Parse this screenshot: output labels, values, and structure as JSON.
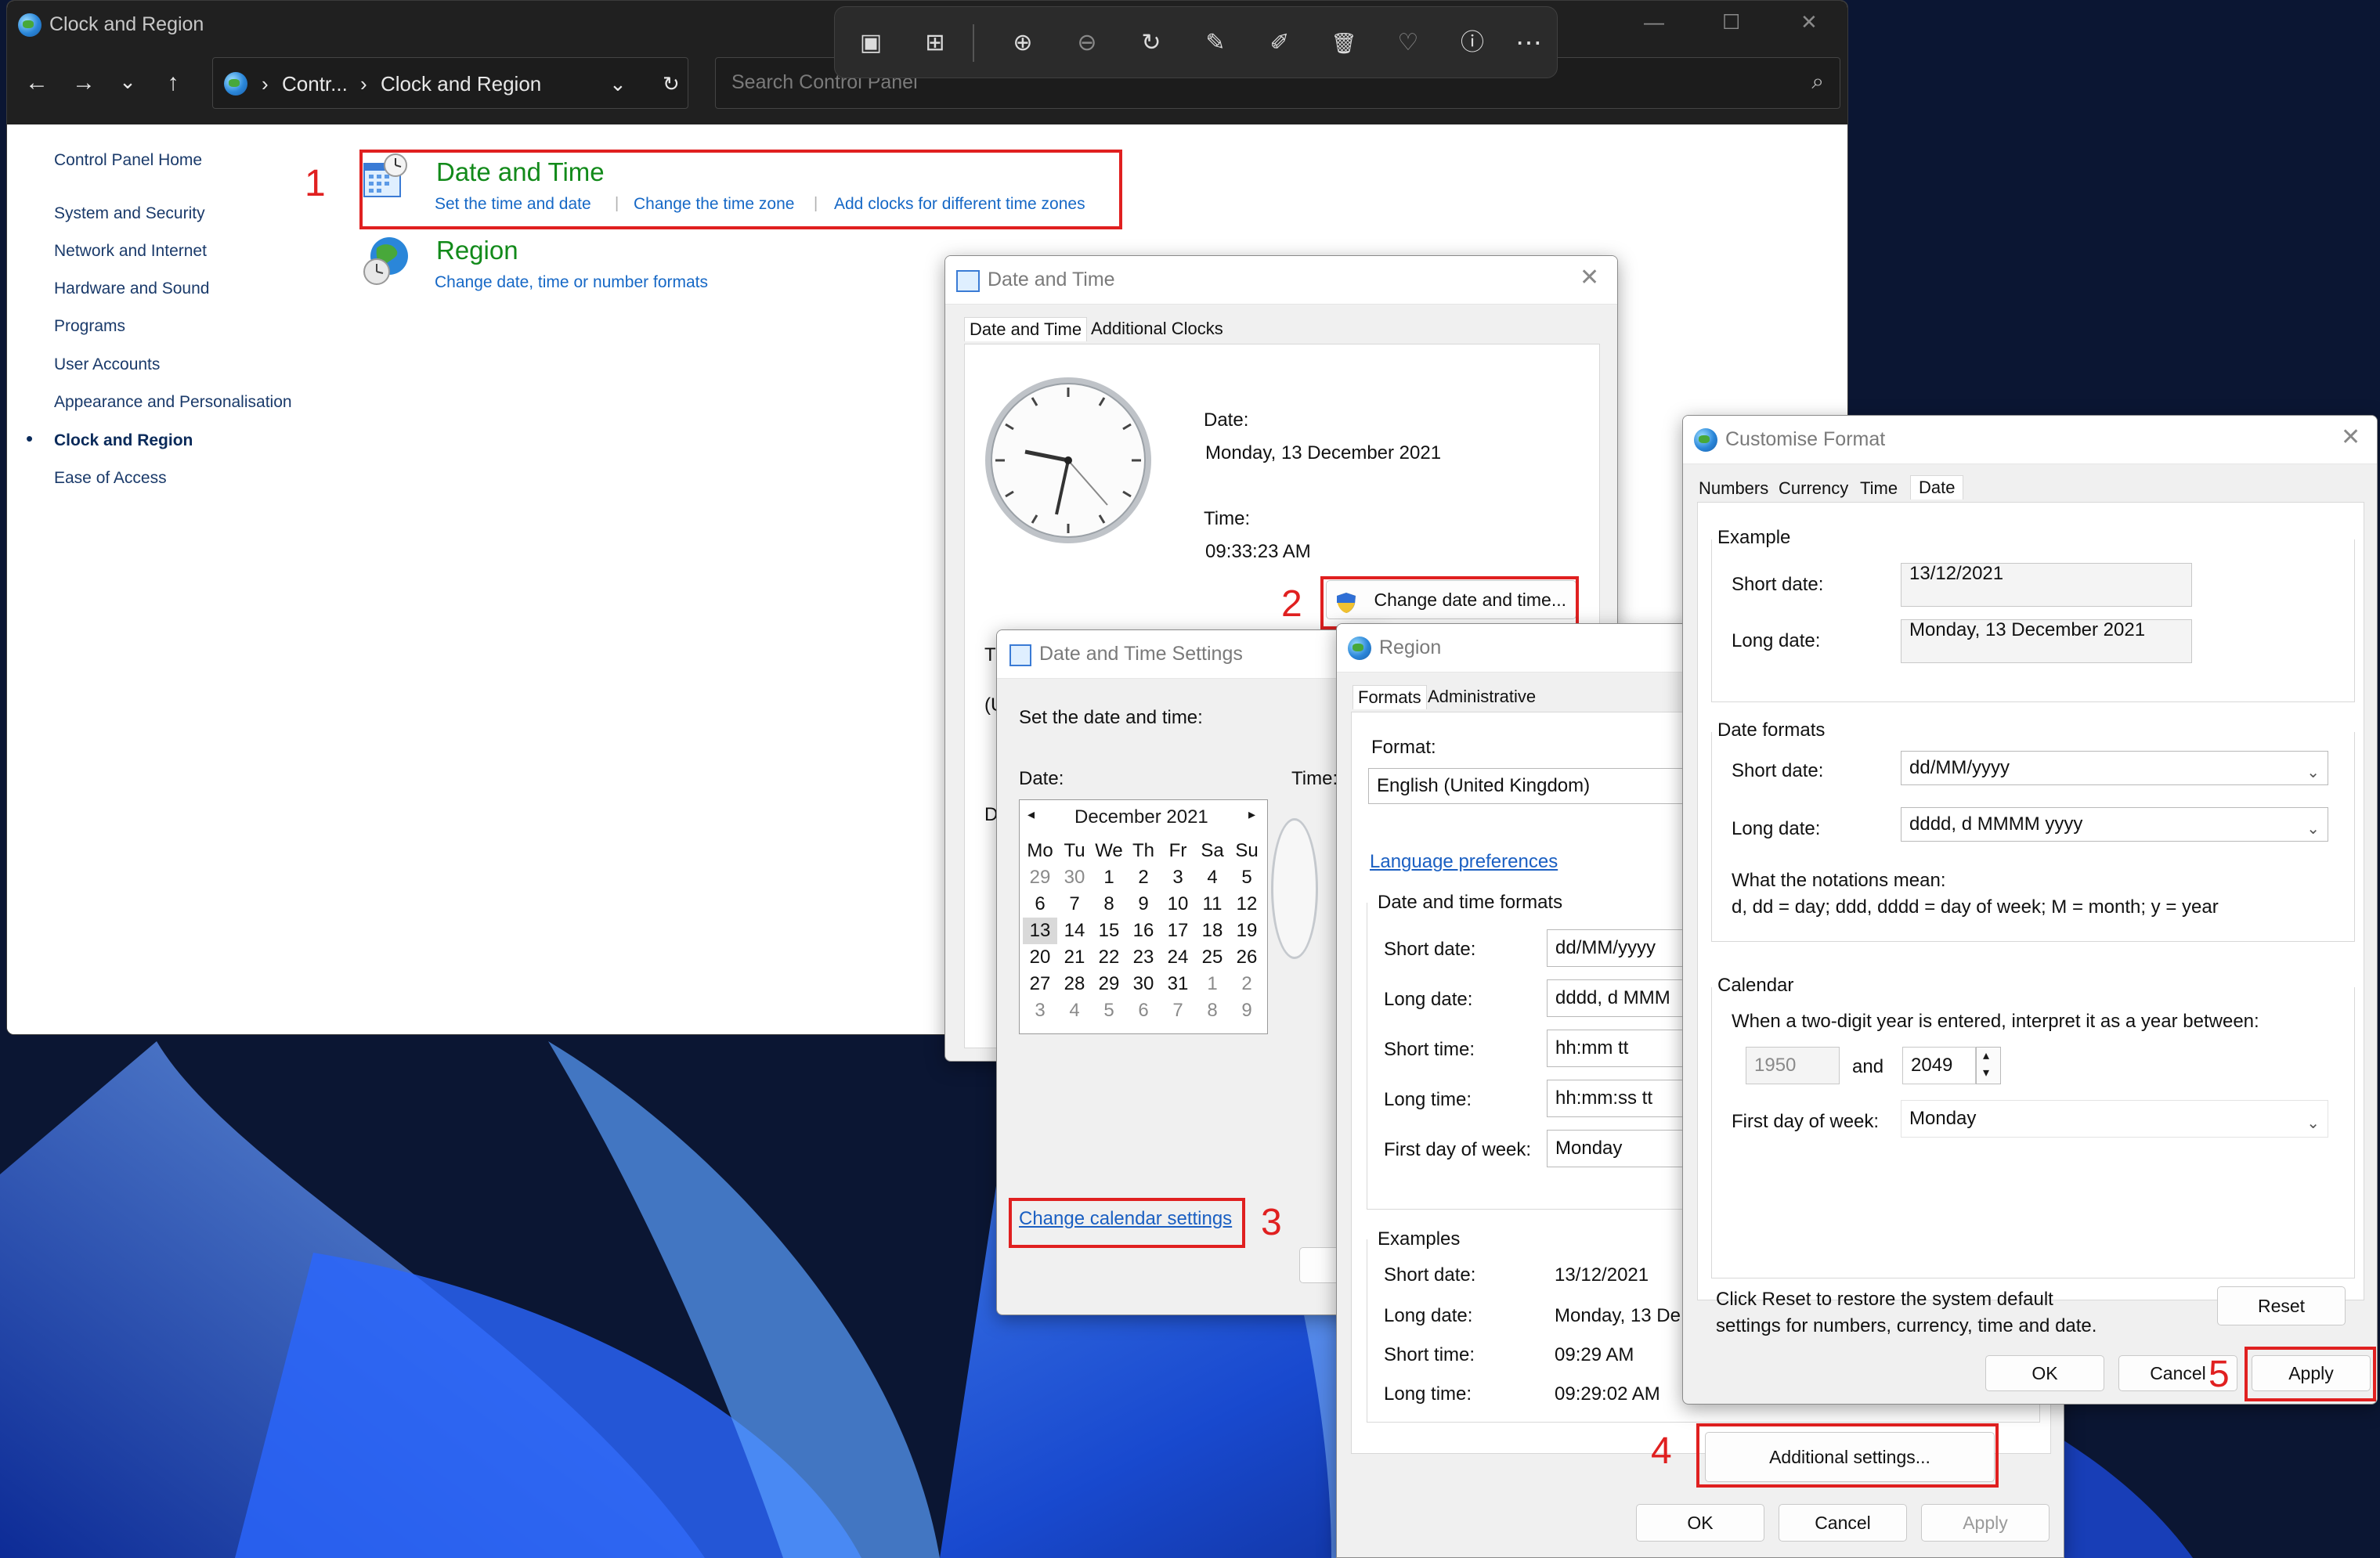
{
  "window": {
    "title": "Clock and Region"
  },
  "nav": {
    "back": "←",
    "forward": "→",
    "recent": "⌄",
    "up": "↑",
    "crumb_sep": "›",
    "crumb_root": "Contr...",
    "crumb_current": "Clock and Region",
    "dropdown": "⌄",
    "refresh": "↻",
    "search_placeholder": "Search Control Panel",
    "search_icon": "⌕"
  },
  "window_controls": {
    "minimize": "—",
    "maximize": "☐",
    "close": "✕"
  },
  "sidebar": {
    "items": [
      "Control Panel Home",
      "System and Security",
      "Network and Internet",
      "Hardware and Sound",
      "Programs",
      "User Accounts",
      "Appearance and Personalisation",
      "Clock and Region",
      "Ease of Access"
    ],
    "bullet": "•"
  },
  "categories": {
    "date_time": {
      "title": "Date and Time",
      "links": [
        "Set the time and date",
        "Change the time zone",
        "Add clocks for different time zones"
      ],
      "sep": "|"
    },
    "region": {
      "title": "Region",
      "links": [
        "Change date, time or number formats"
      ]
    }
  },
  "steps": [
    "1",
    "2",
    "3",
    "4",
    "5"
  ],
  "viewer_toolbar": {
    "icons": [
      "image-icon",
      "gallery-icon",
      "zoom-in-icon",
      "zoom-out-icon",
      "rotate-icon",
      "edit-icon",
      "draw-icon",
      "delete-icon",
      "favorite-icon",
      "info-icon",
      "more-icon"
    ],
    "glyphs": [
      "▣",
      "⊞",
      "⊕",
      "⊖",
      "↻",
      "✎",
      "✐",
      "🗑",
      "♡",
      "ⓘ",
      "⋯"
    ]
  },
  "datetime_dialog": {
    "title": "Date and Time",
    "tabs": [
      "Date and Time",
      "Additional Clocks"
    ],
    "date_label": "Date:",
    "date_value": "Monday, 13 December 2021",
    "time_label": "Time:",
    "time_value": "09:33:23 AM",
    "change_button": "Change date and time...",
    "hidden_t": "T",
    "hidden_paren": "(U",
    "hidden_d": "D"
  },
  "dts_dialog": {
    "title": "Date and Time Settings",
    "prompt": "Set the date and time:",
    "date_label": "Date:",
    "time_label": "Time:",
    "month": "December 2021",
    "prev": "◂",
    "next": "▸",
    "weekdays": [
      "Mo",
      "Tu",
      "We",
      "Th",
      "Fr",
      "Sa",
      "Su"
    ],
    "weeks": [
      [
        "29",
        "30",
        "1",
        "2",
        "3",
        "4",
        "5"
      ],
      [
        "6",
        "7",
        "8",
        "9",
        "10",
        "11",
        "12"
      ],
      [
        "13",
        "14",
        "15",
        "16",
        "17",
        "18",
        "19"
      ],
      [
        "20",
        "21",
        "22",
        "23",
        "24",
        "25",
        "26"
      ],
      [
        "27",
        "28",
        "29",
        "30",
        "31",
        "1",
        "2"
      ],
      [
        "3",
        "4",
        "5",
        "6",
        "7",
        "8",
        "9"
      ]
    ],
    "change_calendar": "Change calendar settings"
  },
  "region_dialog": {
    "title": "Region",
    "tabs": [
      "Formats",
      "Administrative"
    ],
    "format_label": "Format:",
    "format_value": "English (United Kingdom)",
    "lang_link": "Language preferences",
    "dtf_title": "Date and time formats",
    "rows": [
      {
        "label": "Short date:",
        "value": "dd/MM/yyyy"
      },
      {
        "label": "Long date:",
        "value": "dddd, d MMM"
      },
      {
        "label": "Short time:",
        "value": "hh:mm tt"
      },
      {
        "label": "Long time:",
        "value": "hh:mm:ss tt"
      },
      {
        "label": "First day of week:",
        "value": "Monday"
      }
    ],
    "examples_title": "Examples",
    "examples": [
      {
        "label": "Short date:",
        "value": "13/12/2021"
      },
      {
        "label": "Long date:",
        "value": "Monday, 13 De"
      },
      {
        "label": "Short time:",
        "value": "09:29 AM"
      },
      {
        "label": "Long time:",
        "value": "09:29:02 AM"
      }
    ],
    "additional": "Additional settings...",
    "ok": "OK",
    "cancel": "Cancel",
    "apply": "Apply"
  },
  "custom_dialog": {
    "title": "Customise Format",
    "tabs": [
      "Numbers",
      "Currency",
      "Time",
      "Date"
    ],
    "example_title": "Example",
    "short_label": "Short date:",
    "short_value": "13/12/2021",
    "long_label": "Long date:",
    "long_value": "Monday, 13 December 2021",
    "formats_title": "Date formats",
    "short_fmt": "dd/MM/yyyy",
    "long_fmt": "dddd, d MMMM yyyy",
    "notations_title": "What the notations mean:",
    "notations": "d, dd = day;  ddd, dddd = day of week;  M = month;  y = year",
    "calendar_title": "Calendar",
    "calendar_text": "When a two-digit year is entered, interpret it as a year between:",
    "year_from": "1950",
    "and": "and",
    "year_to": "2049",
    "first_day_label": "First day of week:",
    "first_day_value": "Monday",
    "reset_text": "Click Reset to restore the system default settings for numbers, currency, time and date.",
    "reset": "Reset",
    "ok": "OK",
    "cancel": "Cancel",
    "apply": "Apply",
    "spin_up": "▴",
    "spin_down": "▾",
    "combo_arrow": "⌄"
  },
  "colors": {
    "accent_green": "#128a1a",
    "link_blue": "#1668c6",
    "annotation_red": "#e02020",
    "titlebar_dark": "#202020"
  }
}
